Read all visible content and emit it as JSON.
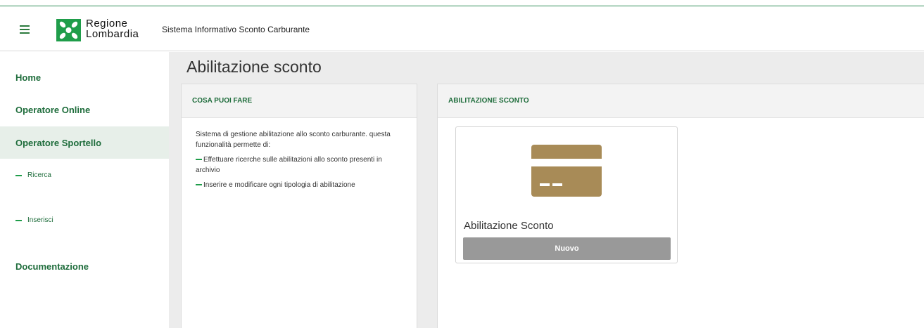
{
  "header": {
    "logo_line1": "Regione",
    "logo_line2": "Lombardia",
    "app_title": "Sistema Informativo Sconto Carburante"
  },
  "sidebar": {
    "items": [
      {
        "label": "Home"
      },
      {
        "label": "Operatore Online"
      },
      {
        "label": "Operatore Sportello",
        "active": true
      },
      {
        "label": "Documentazione"
      }
    ],
    "sub_items": [
      {
        "label": "Ricerca"
      },
      {
        "label": "Inserisci"
      }
    ]
  },
  "main": {
    "page_title": "Abilitazione sconto",
    "left_panel": {
      "header": "COSA PUOI FARE",
      "intro": "Sistema di gestione abilitazione allo sconto carburante. questa funzionalità permette di:",
      "bullets": [
        "Effettuare ricerche sulle abilitazioni allo sconto presenti in archivio",
        "Inserire e modificare ogni tipologia di abilitazione"
      ]
    },
    "right_panel": {
      "header": "ABILITAZIONE SCONTO",
      "card": {
        "icon": "credit-card-icon",
        "title": "Abilitazione Sconto",
        "button_label": "Nuovo"
      }
    }
  },
  "colors": {
    "brand_green": "#1f9d4a",
    "text_green": "#1f6d3c",
    "card_icon": "#a88b57",
    "button_gray": "#999999"
  }
}
